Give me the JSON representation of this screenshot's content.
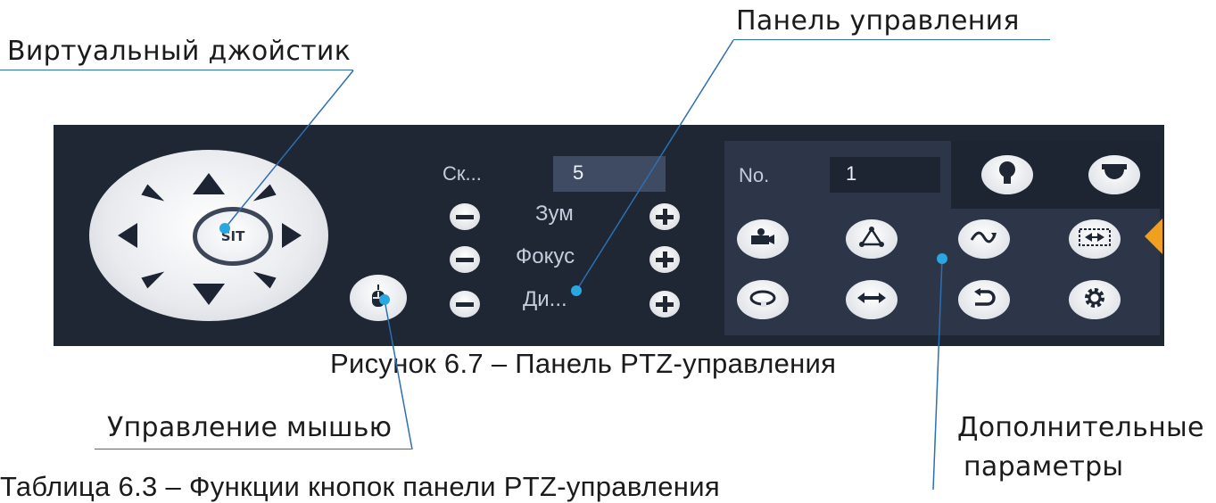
{
  "annotations": {
    "joystick": "Виртуальный джойстик",
    "control_panel": "Панель управления",
    "mouse_control": "Управление мышью",
    "extra_params_line1": "Дополнительные",
    "extra_params_line2": "параметры"
  },
  "caption": "Рисунок 6.7 – Панель PTZ-управления",
  "bottom_text": "Таблица 6.3 – Функции кнопок панели PTZ-управления",
  "ptz_panel": {
    "joystick_center": "SIT",
    "speed_label": "Ск...",
    "speed_value": "5",
    "rows": [
      {
        "label": "Зум"
      },
      {
        "label": "Фокус"
      },
      {
        "label": "Ди..."
      }
    ],
    "number_label": "No.",
    "number_value": "1"
  },
  "icons": {
    "wiper": "bulb-icon",
    "light": "dome-camera-icon",
    "preset": "camera-icon",
    "tour": "tour-icon",
    "pattern": "pattern-icon",
    "scan": "scan-icon",
    "rotate": "rotate-icon",
    "pan": "pan-icon",
    "flip": "flip-icon",
    "settings": "gear-icon",
    "mouse": "mouse-icon",
    "collapse": "collapse-arrow-icon"
  },
  "colors": {
    "panel_bg": "#1f2734",
    "accent": "#f0a020",
    "leader_line": "#2d6fb2"
  }
}
